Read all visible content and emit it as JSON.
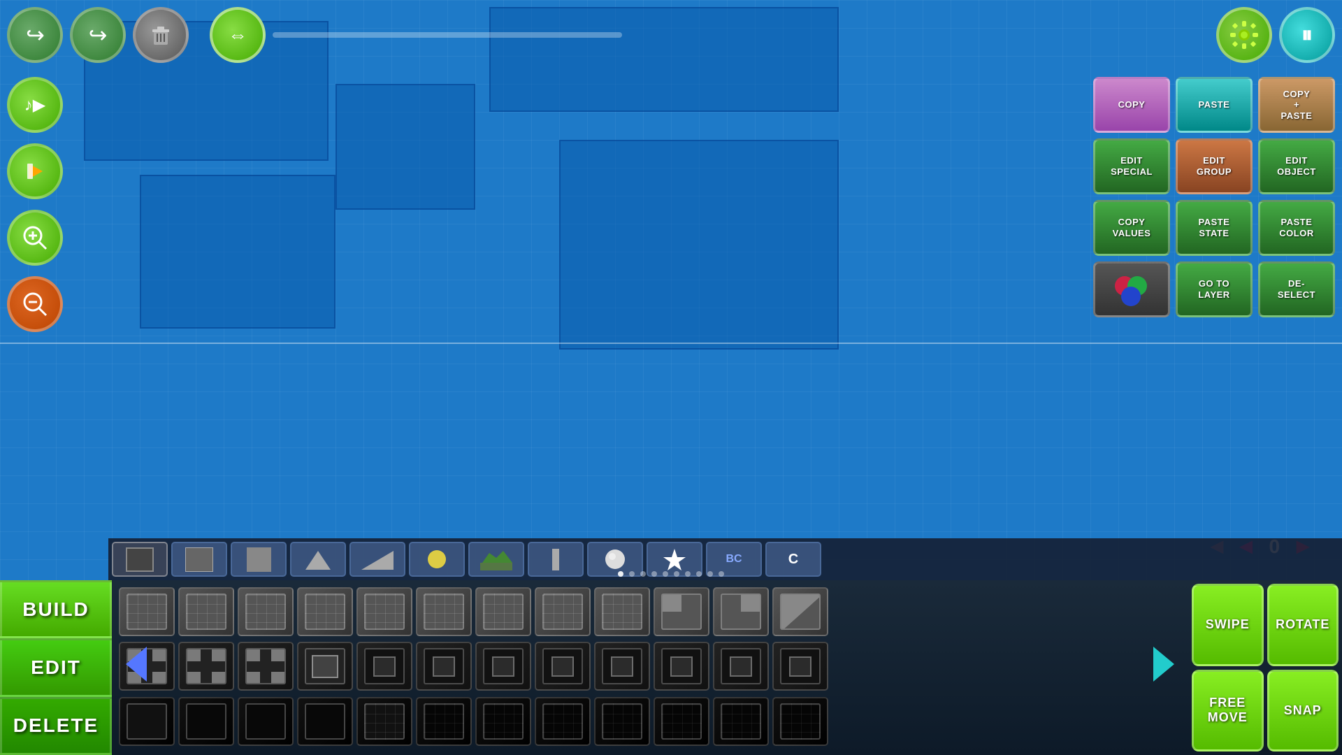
{
  "toolbar": {
    "undo_label": "↩",
    "redo_label": "↪",
    "delete_label": "🗑",
    "settings_label": "⚙",
    "pause_label": "⏸"
  },
  "left_sidebar": {
    "music_label": "♪▶",
    "record_label": "▶⬜",
    "zoomin_label": "🔍+",
    "zoomout_label": "🔍-"
  },
  "edit_panel": {
    "copy": "COPY",
    "paste": "PASTE",
    "copy_paste": "COPY\n+\nPASTE",
    "edit_special": "EDIT\nSPECIAL",
    "edit_group": "EDIT\nGROUP",
    "edit_object": "EDIT\nOBJECT",
    "copy_values": "COPY\nVALUES",
    "paste_state": "PASTE\nSTATE",
    "paste_color": "PASTE\nCOLOR",
    "go_to_layer": "GO TO\nLAYER",
    "deselect": "DE-\nSELECT"
  },
  "nav": {
    "left_outer": "◄",
    "left_inner": "◄",
    "counter": "0",
    "right": "►"
  },
  "mode_buttons": {
    "build": "BUILD",
    "edit": "EDIT",
    "delete": "DELETE"
  },
  "action_buttons": {
    "swipe": "SWIPE",
    "rotate": "ROTATE",
    "free_move": "FREE\nMOVE",
    "snap": "SNAP"
  },
  "dots": [
    0,
    1,
    2,
    3,
    4,
    5,
    6,
    7,
    8,
    9
  ],
  "colors": {
    "bg": "#1e7ac8",
    "grid_line": "rgba(255,255,255,0.05)",
    "btn_green": "#44aa00",
    "btn_teal": "#008888",
    "btn_purple": "#9944aa"
  }
}
